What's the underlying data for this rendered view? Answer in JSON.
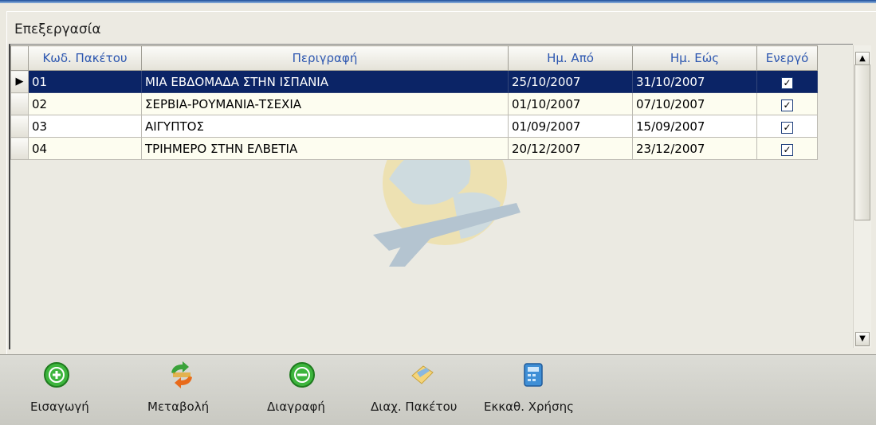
{
  "group_title": "Επεξεργασία",
  "columns": [
    "Κωδ. Πακέτου",
    "Περιγραφή",
    "Ημ. Από",
    "Ημ. Εώς",
    "Ενεργό"
  ],
  "rows": [
    {
      "code": "01",
      "desc": "ΜΙΑ ΕΒΔΟΜΑΔΑ ΣΤΗΝ ΙΣΠΑΝΙΑ",
      "from": "25/10/2007",
      "to": "31/10/2007",
      "active": "✓",
      "selected": true
    },
    {
      "code": "02",
      "desc": "ΣΕΡΒΙΑ-ΡΟΥΜΑΝΙΑ-ΤΣΕΧΙΑ",
      "from": "01/10/2007",
      "to": "07/10/2007",
      "active": "✓",
      "selected": false
    },
    {
      "code": "03",
      "desc": "ΑΙΓΥΠΤΟΣ",
      "from": "01/09/2007",
      "to": "15/09/2007",
      "active": "✓",
      "selected": false
    },
    {
      "code": "04",
      "desc": "ΤΡΙΗΜΕΡΟ ΣΤΗΝ ΕΛΒΕΤΙΑ",
      "from": "20/12/2007",
      "to": "23/12/2007",
      "active": "✓",
      "selected": false
    }
  ],
  "row_pointer": "▶",
  "scroll": {
    "up": "▲",
    "down": "▼"
  },
  "toolbar": {
    "insert": "Εισαγωγή",
    "edit": "Μεταβολή",
    "delete": "Διαγραφή",
    "manage_package": "Διαχ. Πακέτου",
    "clear_usage": "Εκκαθ. Χρήσης"
  },
  "icons": {
    "insert": "plus-circle-icon",
    "edit": "refresh-arrows-icon",
    "delete": "minus-circle-icon",
    "manage_package": "package-icon",
    "clear_usage": "calculator-icon"
  },
  "colors": {
    "header_text": "#2d57b0",
    "selected_row": "#0b2466",
    "alt_row": "#fdfdf0"
  }
}
